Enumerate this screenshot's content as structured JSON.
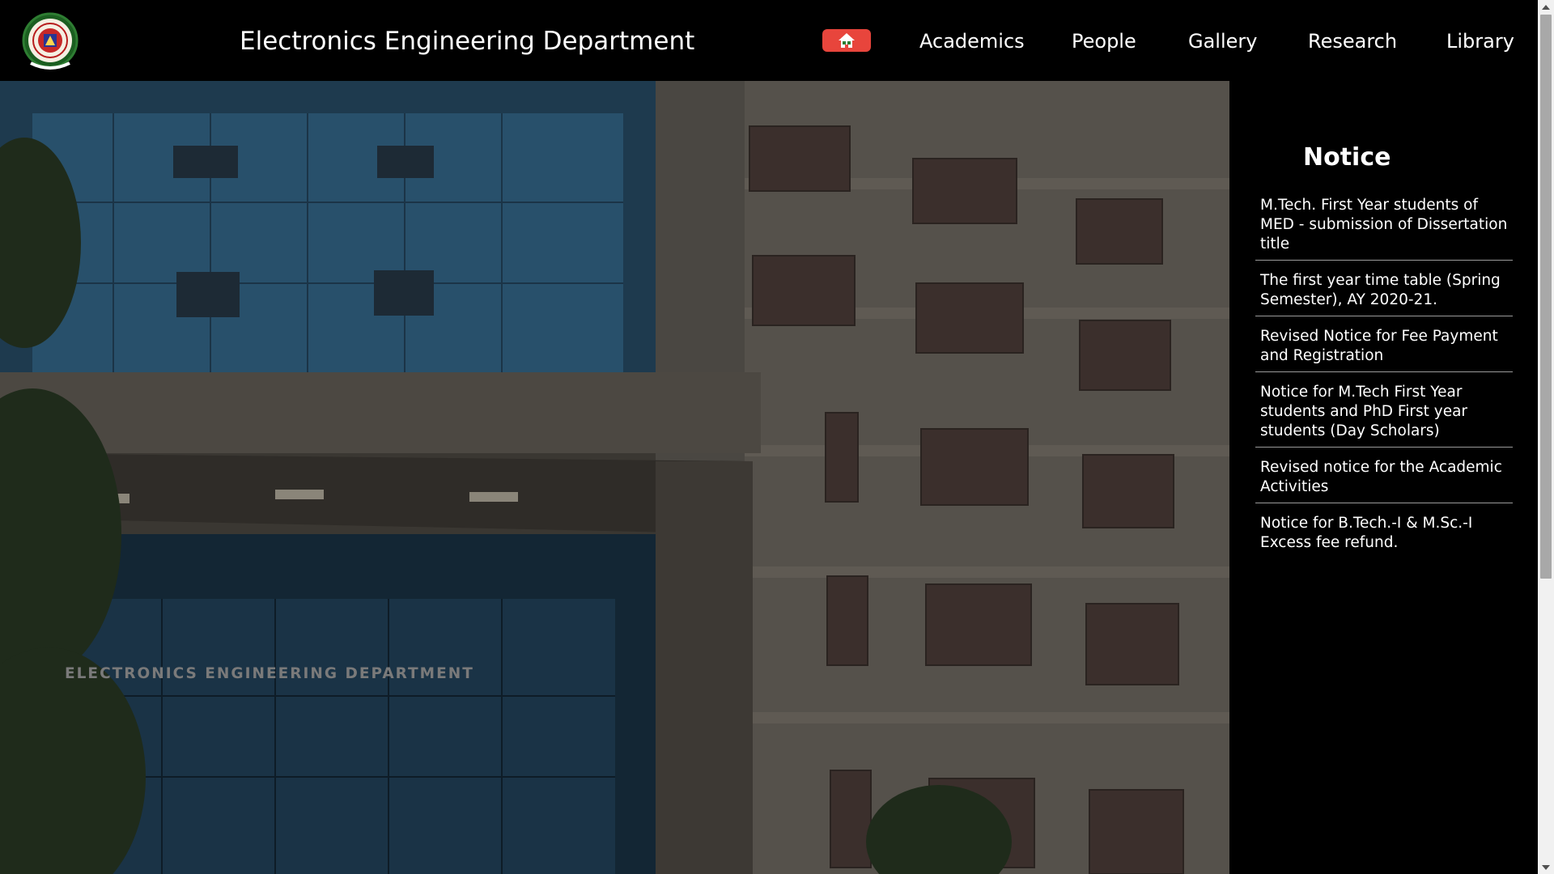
{
  "header": {
    "title": "Electronics Engineering Department",
    "home_icon": "home-icon",
    "accent_color": "#e8453c"
  },
  "nav": {
    "items": [
      {
        "label": "Academics"
      },
      {
        "label": "People"
      },
      {
        "label": "Gallery"
      },
      {
        "label": "Research"
      },
      {
        "label": "Library"
      }
    ]
  },
  "hero": {
    "sign_text": "ELECTRONICS ENGINEERING DEPARTMENT"
  },
  "notice": {
    "title": "Notice",
    "items": [
      "M.Tech. First Year students of MED - submission of Dissertation title",
      "The first year time table (Spring Semester), AY 2020-21.",
      "Revised Notice for Fee Payment and Registration",
      "Notice for M.Tech First Year students and PhD First year students (Day Scholars)",
      "Revised notice for the Academic Activities",
      "Notice for B.Tech.-I & M.Sc.-I Excess fee refund."
    ]
  }
}
